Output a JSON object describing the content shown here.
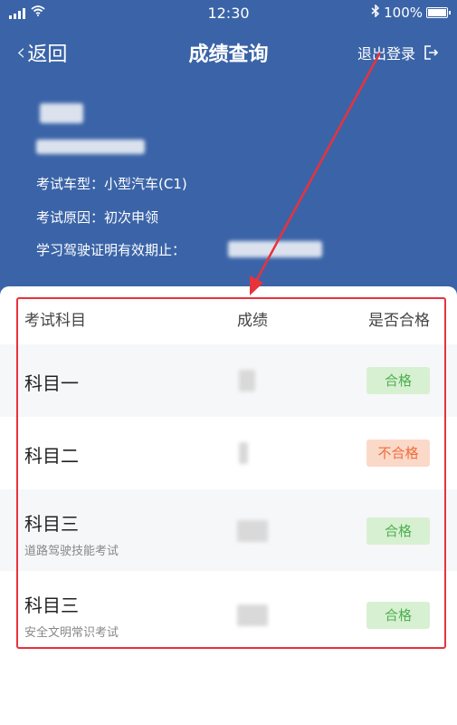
{
  "status_bar": {
    "time": "12:30",
    "battery_text": "100%",
    "battery_level": 1.0,
    "icons": [
      "signal-icon",
      "wifi-icon",
      "bluetooth-icon",
      "battery-icon"
    ]
  },
  "nav": {
    "back_label": "返回",
    "title": "成绩查询",
    "logout_label": "退出登录"
  },
  "profile": {
    "vehicle_type_label": "考试车型：",
    "vehicle_type_value": "小型汽车(C1)",
    "reason_label": "考试原因：",
    "reason_value": "初次申领",
    "license_validity_label": "学习驾驶证明有效期止："
  },
  "table": {
    "headers": {
      "subject": "考试科目",
      "score": "成绩",
      "pass": "是否合格"
    },
    "rows": [
      {
        "subject": "科目一",
        "subtitle": "",
        "result": "合格",
        "status": "pass"
      },
      {
        "subject": "科目二",
        "subtitle": "",
        "result": "不合格",
        "status": "fail"
      },
      {
        "subject": "科目三",
        "subtitle": "道路驾驶技能考试",
        "result": "合格",
        "status": "pass"
      },
      {
        "subject": "科目三",
        "subtitle": "安全文明常识考试",
        "result": "合格",
        "status": "pass"
      }
    ]
  },
  "colors": {
    "header_bg": "#3b64a8",
    "pass_bg": "#d8f0d2",
    "pass_text": "#4caf50",
    "fail_bg": "#fbd9c8",
    "fail_text": "#ef6c3b",
    "annotation_red": "#e8323c"
  }
}
